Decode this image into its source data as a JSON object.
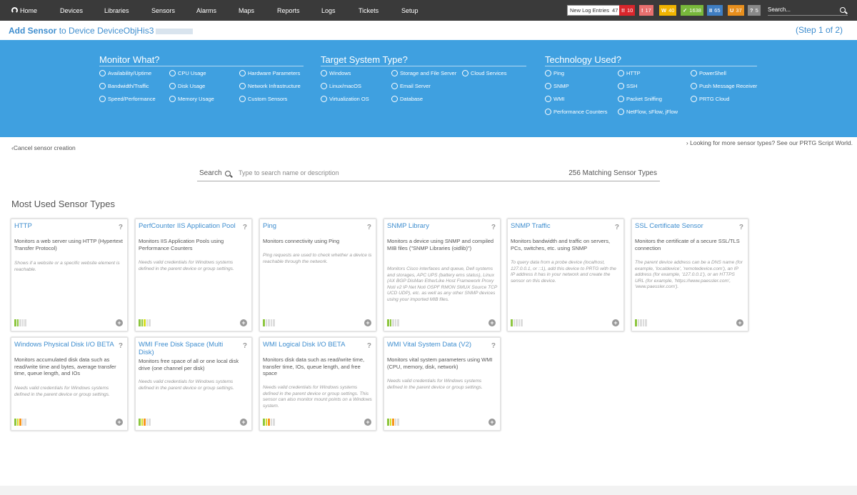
{
  "nav": {
    "home": "Home",
    "items": [
      "Devices",
      "Libraries",
      "Sensors",
      "Alarms",
      "Maps",
      "Reports",
      "Logs",
      "Tickets",
      "Setup"
    ],
    "log_label": "New Log Entries",
    "log_count": "47",
    "badges": [
      {
        "icon": "!!",
        "count": "10",
        "color": "#d9262c"
      },
      {
        "icon": "!",
        "count": "17",
        "color": "#e7706f"
      },
      {
        "icon": "W",
        "count": "40",
        "color": "#f0b400"
      },
      {
        "icon": "✓",
        "count": "1638",
        "color": "#78b83b"
      },
      {
        "icon": "II",
        "count": "65",
        "color": "#3f7ec2"
      },
      {
        "icon": "U",
        "count": "37",
        "color": "#e88f1d"
      },
      {
        "icon": "?",
        "count": "5",
        "color": "#8a8a8a"
      }
    ],
    "search_placeholder": "Search..."
  },
  "header": {
    "add_sensor": "Add Sensor",
    "to_device": "to Device",
    "device_name": "DeviceObjHis3",
    "step": "(Step 1 of 2)"
  },
  "filters": {
    "monitor": {
      "title": "Monitor What?",
      "options": [
        "Availability/Uptime",
        "Bandwidth/Traffic",
        "Speed/Performance",
        "CPU Usage",
        "Disk Usage",
        "Memory Usage",
        "Hardware Parameters",
        "Network Infrastructure",
        "Custom Sensors"
      ]
    },
    "target": {
      "title": "Target System Type?",
      "options": [
        "Windows",
        "Linux/macOS",
        "Virtualization OS",
        "Storage and File Server",
        "Email Server",
        "Database",
        "Cloud Services"
      ]
    },
    "technology": {
      "title": "Technology Used?",
      "options": [
        "Ping",
        "SNMP",
        "WMI",
        "Performance Counters",
        "HTTP",
        "SSH",
        "Packet Sniffing",
        "NetFlow, sFlow, jFlow",
        "PowerShell",
        "Push Message Receiver",
        "PRTG Cloud"
      ]
    }
  },
  "links": {
    "cancel": "Cancel sensor creation",
    "more": "Looking for more sensor types? See our PRTG Script World."
  },
  "search": {
    "label": "Search",
    "placeholder": "Type to search name or description",
    "matching": "256 Matching Sensor Types"
  },
  "section_title": "Most Used Sensor Types",
  "cards": [
    {
      "title": "HTTP",
      "desc": "Monitors a web server using HTTP (Hypertext Transfer Protocol)",
      "note": "Shows if a website or a specific website element is reachable.",
      "bars": [
        "#8dc63f",
        "#8dc63f",
        "#ddd",
        "#ddd",
        "#ddd"
      ]
    },
    {
      "title": "PerfCounter IIS Application Pool",
      "desc": "Monitors IIS Application Pools using Performance Counters",
      "note": "Needs valid credentials for Windows systems defined in the parent device or group settings.",
      "bars": [
        "#8dc63f",
        "#8dc63f",
        "#d7df23",
        "#ddd",
        "#ddd"
      ]
    },
    {
      "title": "Ping",
      "desc": "Monitors connectivity using Ping",
      "note": "Ping requests are used to check whether a device is reachable through the network.",
      "bars": [
        "#8dc63f",
        "#ddd",
        "#ddd",
        "#ddd",
        "#ddd"
      ]
    },
    {
      "title": "SNMP Library",
      "desc": "Monitors a device using SNMP and compiled MIB files (\"SNMP Libraries (oidlib)\")",
      "note": "Monitors Cisco interfaces and queue, Dell systems and storages, APC UPS (battery ems status), Linux (AX BGP DisMan EtherLike Host Framework Proxy Noti v2 IP Net Noti OSPF RMON SMUX Source TCP UCD UDP), etc. as well as any other SNMP devices using your imported MIB files.",
      "bars": [
        "#8dc63f",
        "#8dc63f",
        "#ddd",
        "#ddd",
        "#ddd"
      ]
    },
    {
      "title": "SNMP Traffic",
      "desc": "Monitors bandwidth and traffic on servers, PCs, switches, etc. using SNMP",
      "note": "To query data from a probe device (localhost, 127.0.0.1, or ::1), add this device to PRTG with the IP address it has in your network and create the sensor on this device.",
      "bars": [
        "#8dc63f",
        "#ddd",
        "#ddd",
        "#ddd",
        "#ddd"
      ]
    },
    {
      "title": "SSL Certificate Sensor",
      "desc": "Monitors the certificate of a secure SSL/TLS connection",
      "note": "The parent device address can be a DNS name (for example, 'localdevice', 'remotedevice.com'), an IP address (for example, '127.0.0.1'), or an HTTPS URL (for example, 'https://www.paessler.com', 'www.paessler.com').",
      "bars": [
        "#8dc63f",
        "#ddd",
        "#ddd",
        "#ddd",
        "#ddd"
      ]
    },
    {
      "title": "Windows Physical Disk I/O BETA",
      "desc": "Monitors accumulated disk data such as read/write time and bytes, average transfer time, queue length, and IOs",
      "note": "Needs valid credentials for Windows systems defined in the parent device or group settings.",
      "bars": [
        "#8dc63f",
        "#d7df23",
        "#f7941d",
        "#ddd",
        "#ddd"
      ]
    },
    {
      "title": "WMI Free Disk Space (Multi Disk)",
      "desc": "Monitors free space of all or one local disk drive (one channel per disk)",
      "note": "Needs valid credentials for Windows systems defined in the parent device or group settings.",
      "bars": [
        "#8dc63f",
        "#d7df23",
        "#f7941d",
        "#ddd",
        "#ddd"
      ]
    },
    {
      "title": "WMI Logical Disk I/O BETA",
      "desc": "Monitors disk data such as read/write time, transfer time, IOs, queue length, and free space",
      "note": "Needs valid credentials for Windows systems defined in the parent device or group settings. This sensor can also monitor mount points on a Windows system.",
      "bars": [
        "#8dc63f",
        "#d7df23",
        "#f7941d",
        "#ddd",
        "#ddd"
      ]
    },
    {
      "title": "WMI Vital System Data (V2)",
      "desc": "Monitors vital system parameters using WMI (CPU, memory, disk, network)",
      "note": "Needs valid credentials for Windows systems defined in the parent device or group settings.",
      "bars": [
        "#8dc63f",
        "#d7df23",
        "#f7941d",
        "#ddd",
        "#ddd"
      ]
    }
  ]
}
